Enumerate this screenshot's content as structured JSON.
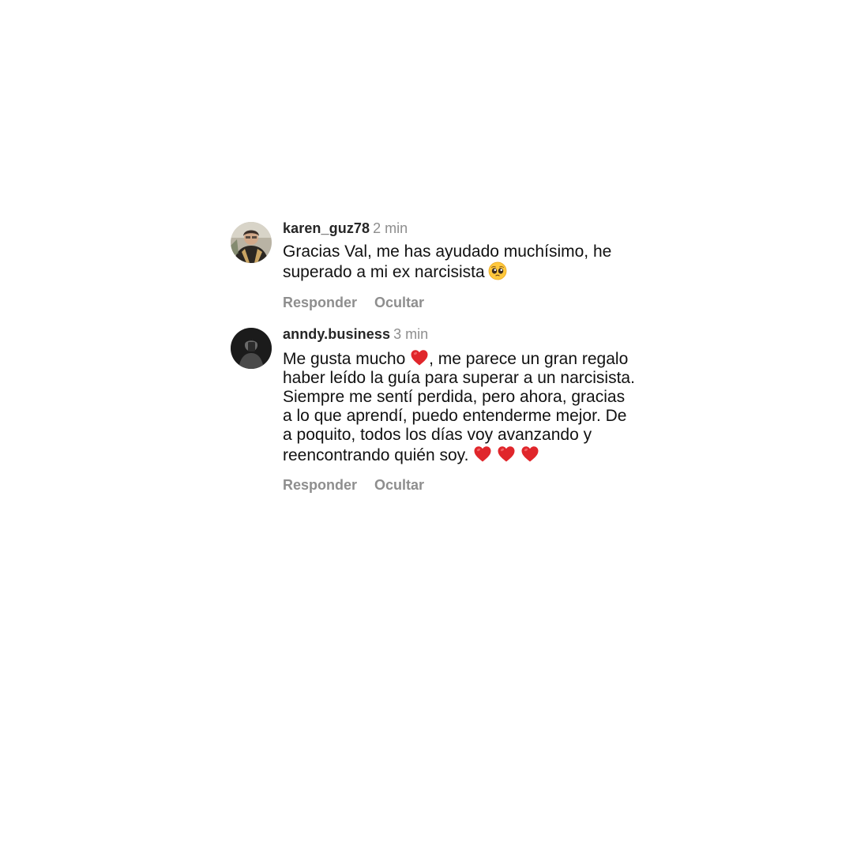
{
  "comments": [
    {
      "username": "karen_guz78",
      "time": "2 min",
      "text_parts": [
        "Gracias Val, me has ayudado muchísimo, he superado a mi ex narcisista"
      ],
      "emojis": [
        "pleading-face"
      ],
      "actions": {
        "reply": "Responder",
        "hide": "Ocultar"
      }
    },
    {
      "username": "anndy.business",
      "time": "3 min",
      "text_parts": [
        "Me gusta mucho",
        ", me parece un gran regalo haber leído la guía para superar a un narcisista. Siempre me sentí perdida, pero ahora, gracias a lo que aprendí, puedo entenderme mejor. De a poquito, todos los días voy avanzando y reencontrando quién soy."
      ],
      "emojis": [
        "red-heart",
        "red-heart",
        "red-heart",
        "red-heart"
      ],
      "actions": {
        "reply": "Responder",
        "hide": "Ocultar"
      }
    }
  ],
  "colors": {
    "text": "#111111",
    "username": "#262626",
    "secondary": "#8e8e8e",
    "background": "#ffffff",
    "heart": "#e0262b"
  }
}
